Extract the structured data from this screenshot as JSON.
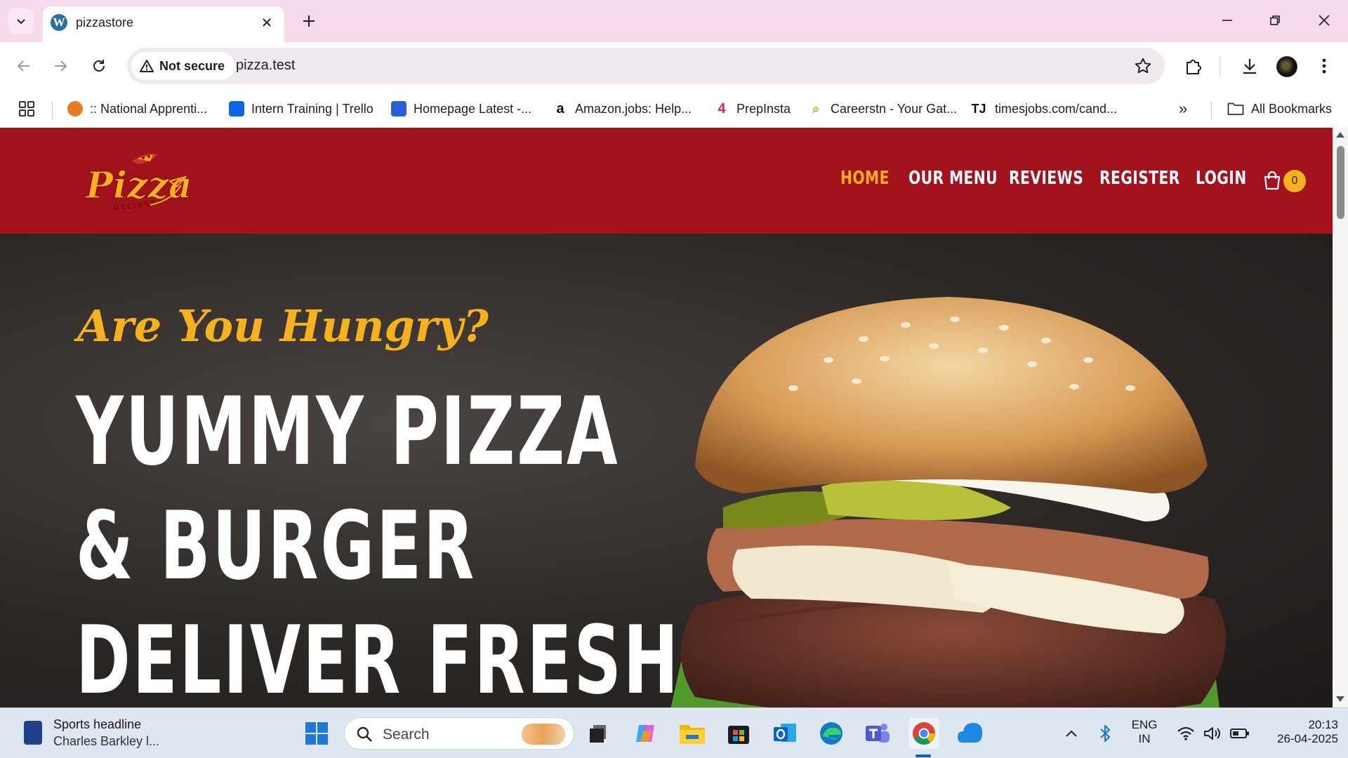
{
  "browser": {
    "tab": {
      "title": "pizzastore",
      "favicon_letter": "W"
    },
    "address_bar": {
      "security_label": "Not secure",
      "url": "pizza.test"
    },
    "bookmarks": [
      {
        "label": ":: National Apprenti...",
        "icon_color": "#e67e22"
      },
      {
        "label": "Intern Training | Trello",
        "icon_color": "#0c66e4"
      },
      {
        "label": "Homepage Latest -...",
        "icon_color": "#2b5fd9"
      },
      {
        "label": "Amazon.jobs: Help...",
        "icon_color": "#ff9900"
      },
      {
        "label": "PrepInsta",
        "icon_color": "#e91e63"
      },
      {
        "label": "Careerstn - Your Gat...",
        "icon_color": "#f39c12"
      },
      {
        "label": "timesjobs.com/cand...",
        "icon_color": "#111111"
      }
    ],
    "bookmarks_overflow": "»",
    "all_bookmarks_label": "All Bookmarks"
  },
  "site": {
    "logo": {
      "word": "Pizza",
      "sub": "DELIVERY"
    },
    "nav": [
      {
        "label": "HOME",
        "active": true
      },
      {
        "label": "OUR MENU",
        "active": false
      },
      {
        "label": "REVIEWS",
        "active": false
      },
      {
        "label": "REGISTER",
        "active": false
      },
      {
        "label": "LOGIN",
        "active": false
      }
    ],
    "cart_count": "0",
    "hero": {
      "tagline": "Are You Hungry?",
      "headline": [
        "YUMMY PIZZA",
        "& BURGER",
        "DELIVER FRESH"
      ]
    },
    "colors": {
      "header_red": "#a3111d",
      "accent_yellow": "#f7b21b",
      "hero_dark": "#2a2624"
    }
  },
  "taskbar": {
    "news": {
      "title": "Sports headline",
      "subtitle": "Charles Barkley l..."
    },
    "search_placeholder": "Search",
    "tray": {
      "language": "ENG",
      "region": "IN",
      "time": "20:13",
      "date": "26-04-2025"
    }
  }
}
